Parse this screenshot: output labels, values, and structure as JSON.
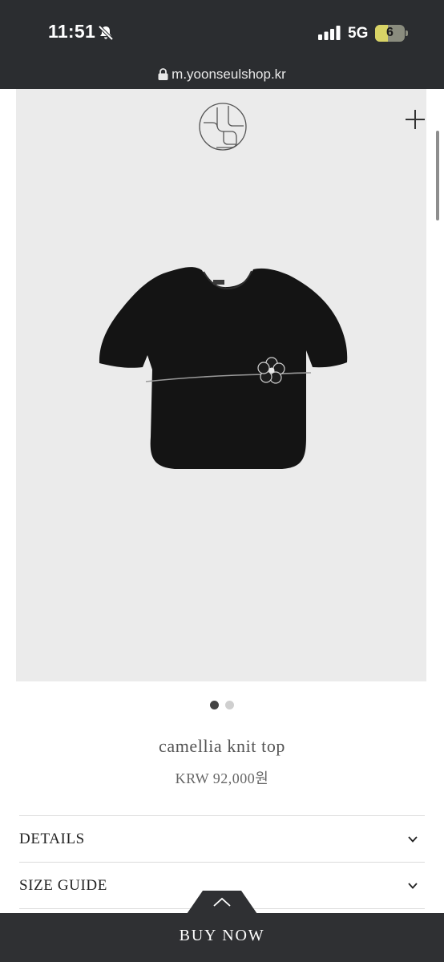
{
  "status_bar": {
    "time": "11:51",
    "network": "5G",
    "battery": "6",
    "icons": [
      "bell-off-icon",
      "signal-bars-icon",
      "battery-icon"
    ]
  },
  "browser": {
    "url": "m.yoonseulshop.kr"
  },
  "header": {
    "menu_icon": "plus-icon",
    "logo": "brand-monogram"
  },
  "gallery": {
    "image": "black cropped knit top with camellia brooch",
    "pages": 2,
    "current_page": 1
  },
  "product": {
    "name": "camellia knit top",
    "price": "KRW 92,000원"
  },
  "sections": [
    {
      "label": "DETAILS"
    },
    {
      "label": "SIZE GUIDE"
    }
  ],
  "cta": {
    "label": "BUY NOW",
    "toggle_icon": "chevron-up-icon"
  },
  "colors": {
    "status_bar_bg": "#2b2d30",
    "hero_bg": "#ebebeb",
    "cta_bg": "#2f3033",
    "battery_fill": "#d8d366"
  }
}
